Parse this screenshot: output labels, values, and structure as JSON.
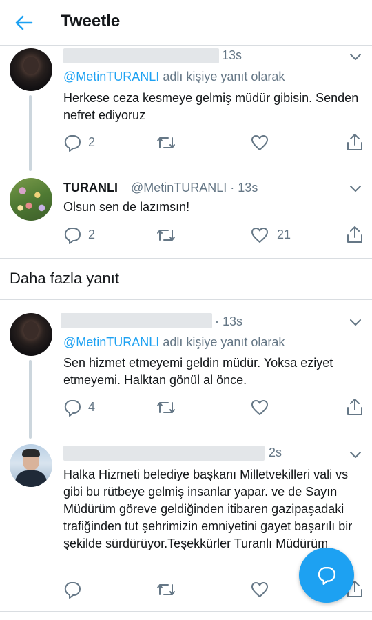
{
  "header": {
    "title": "Tweetle"
  },
  "tweets": [
    {
      "time": "13s",
      "reply_prefix": "",
      "reply_mention": "@MetinTURANLI",
      "reply_suffix": " adlı kişiye yanıt olarak",
      "text": "Herkese ceza kesmeye gelmiş müdür gibisin. Senden nefret ediyoruz",
      "reply_count": "2",
      "like_count": ""
    },
    {
      "name": "TURANLI",
      "handle_time": "@MetinTURANLI · 13s",
      "text": "Olsun sen de lazımsın!",
      "reply_count": "2",
      "like_count": "21"
    },
    {
      "time": "· 13s",
      "reply_mention": "@MetinTURANLI",
      "reply_suffix": " adlı kişiye yanıt olarak",
      "text": "Sen hizmet etmeyemi geldin müdür. Yoksa eziyet etmeyemi. Halktan gönül al önce.",
      "reply_count": "4",
      "like_count": ""
    },
    {
      "time": "2s",
      "text": "Halka Hizmeti belediye başkanı Milletvekilleri vali vs gibi bu rütbeye gelmiş insanlar yapar. ve de Sayın Müdürüm göreve geldiğinden itibaren gazipaşadaki trafiğinden tut şehrimizin emniyetini gayet başarılı bir şekilde sürdürüyor.Teşekkürler Turanlı Müdürüm",
      "reply_count": "",
      "like_count": ""
    }
  ],
  "more_replies": "Daha fazla yanıt",
  "colors": {
    "accent": "#1da1f2",
    "muted": "#657786",
    "divider": "#d9dde1"
  },
  "icons": [
    "back-arrow-icon",
    "chevron-down-icon",
    "reply-icon",
    "retweet-icon",
    "like-icon",
    "share-icon",
    "compose-reply-icon"
  ]
}
